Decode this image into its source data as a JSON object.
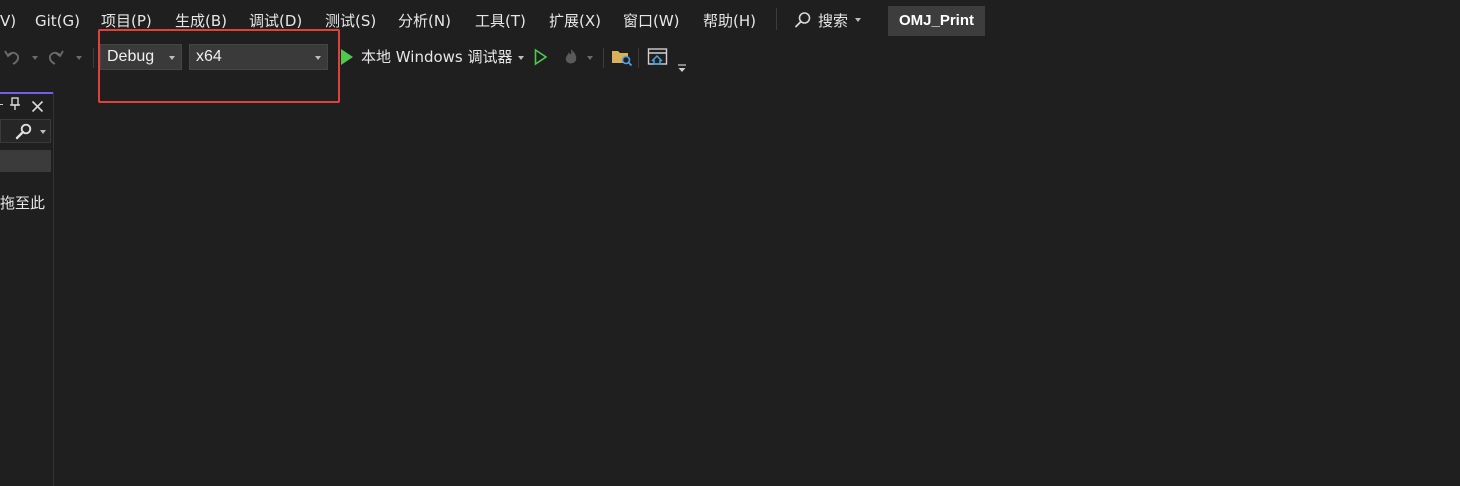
{
  "menu": {
    "items": [
      {
        "label": "V)"
      },
      {
        "label": "Git(G)"
      },
      {
        "label": "项目(P)"
      },
      {
        "label": "生成(B)"
      },
      {
        "label": "调试(D)"
      },
      {
        "label": "测试(S)"
      },
      {
        "label": "分析(N)"
      },
      {
        "label": "工具(T)"
      },
      {
        "label": "扩展(X)"
      },
      {
        "label": "窗口(W)"
      },
      {
        "label": "帮助(H)"
      }
    ],
    "search_label": "搜索",
    "solution_name": "OMJ_Print"
  },
  "toolbar": {
    "configuration": "Debug",
    "platform": "x64",
    "start_debugger_label": "本地 Windows 调试器",
    "highlight_color": "#e0413b",
    "start_color": "#4ec94e"
  },
  "left_panel": {
    "partial_text": "拖至此",
    "accent_color": "#7160e8"
  }
}
